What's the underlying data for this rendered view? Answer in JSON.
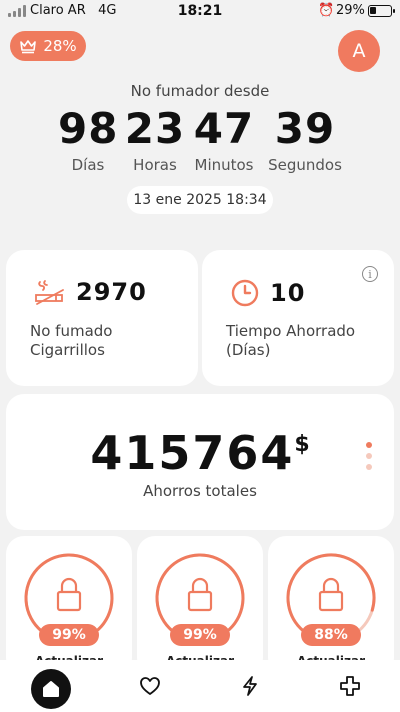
{
  "status_bar": {
    "carrier": "Claro AR",
    "network": "4G",
    "time": "18:21",
    "battery": "29%",
    "battery_level": 0.29,
    "icons": [
      "signal-icon",
      "alarm-icon",
      "battery-icon"
    ]
  },
  "header": {
    "premium_badge": "28%",
    "premium_icon": "crown-icon",
    "avatar_letter": "A"
  },
  "counter": {
    "label": "No fumador desde",
    "days": "98",
    "days_label": "Días",
    "hours": "23",
    "hours_label": "Horas",
    "minutes": "47",
    "minutes_label": "Minutos",
    "seconds": "39",
    "seconds_label": "Segundos",
    "start_date": "13 ene 2025 18:34"
  },
  "stats": {
    "cigarettes_value": "2970",
    "cigarettes_label_1": "No fumado",
    "cigarettes_label_2": "Cigarrillos",
    "cigarettes_icon": "no-smoking-icon",
    "time_value": "10",
    "time_label_1": "Tiempo Ahorrado",
    "time_label_2": "(Días)",
    "time_icon": "clock-icon",
    "info_icon": "info-icon",
    "info_glyph": "i"
  },
  "savings": {
    "amount": "415764",
    "currency": "$",
    "label": "Ahorros totales",
    "page_count": 3,
    "active_page": 0
  },
  "health_cards": [
    {
      "percent": "99%",
      "progress": 0.99,
      "label": "Actualizar",
      "icon": "lock-icon"
    },
    {
      "percent": "99%",
      "progress": 0.99,
      "label": "Actualizar",
      "icon": "lock-icon"
    },
    {
      "percent": "88%",
      "progress": 0.88,
      "label": "Actualizar",
      "icon": "lock-icon"
    }
  ],
  "bottom_nav": {
    "items": [
      "home-icon",
      "heart-icon",
      "lightning-icon",
      "medical-cross-icon"
    ],
    "active": "home-icon"
  },
  "colors": {
    "accent": "#ef7b5e",
    "accent_light": "#f5c9bc",
    "background": "#f2f2f2",
    "card": "#ffffff",
    "text": "#111111"
  }
}
